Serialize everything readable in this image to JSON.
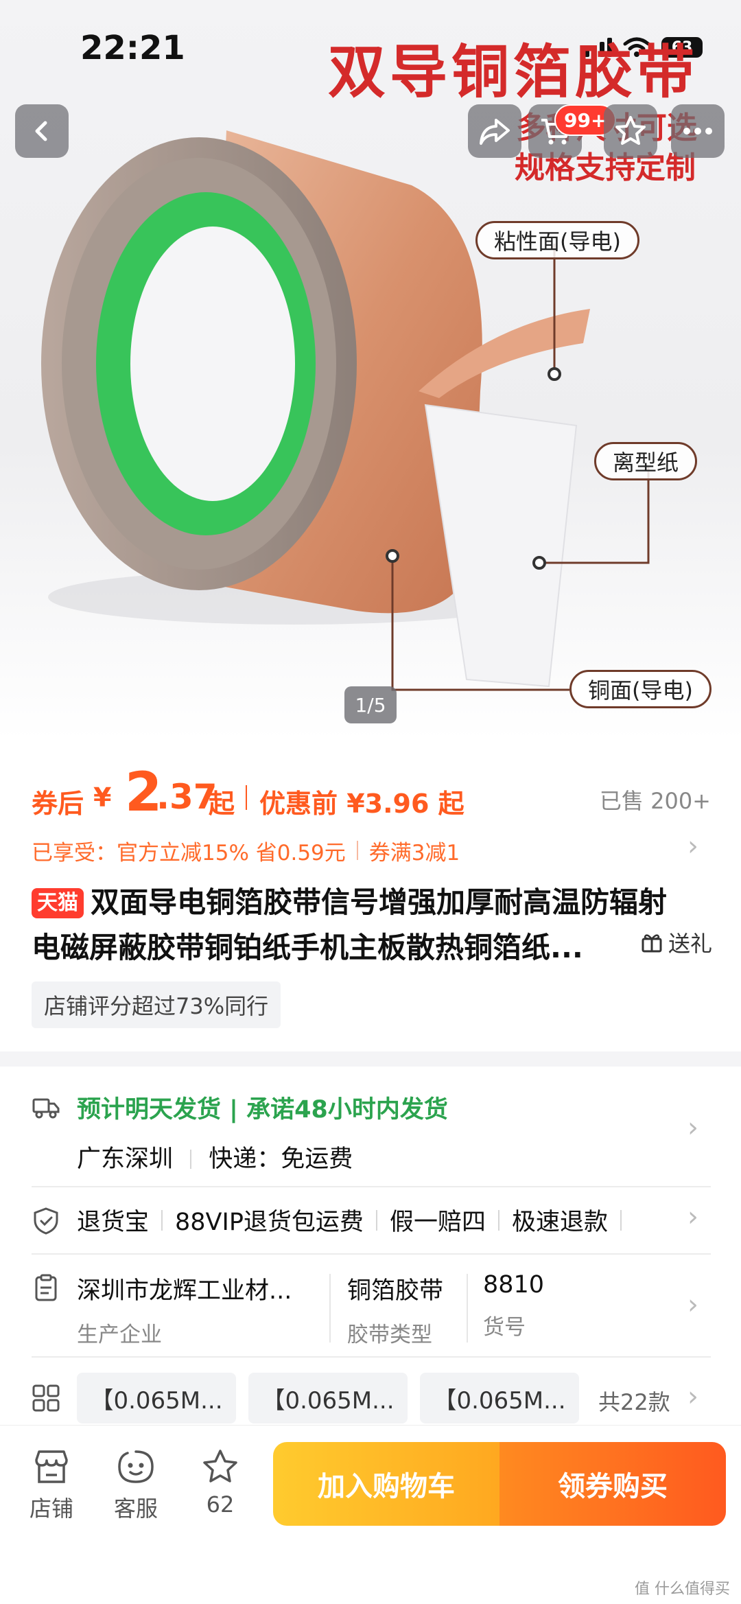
{
  "status_bar": {
    "time": "22:21",
    "battery": "63"
  },
  "hero": {
    "headline": "双导铜箔胶带",
    "sub_line1": "多种尺寸可选",
    "sub_line2": "规格支持定制",
    "callouts": {
      "adhesive": "粘性面(导电)",
      "release": "离型纸",
      "copper": "铜面(导电)"
    },
    "pager": "1/5",
    "cart_badge": "99+"
  },
  "price": {
    "label": "券后",
    "currency": "¥",
    "integer": "2",
    "decimal": ".37",
    "suffix": "起",
    "before_price": "优惠前 ¥3.96 起",
    "sold": "已售 200+"
  },
  "benefit": {
    "text1": "已享受：官方立减15% 省0.59元",
    "text2": "券满3减1"
  },
  "product": {
    "store_badge": "天猫",
    "title_line1": "双面导电铜箔胶带信号增强加厚耐高温防辐射",
    "title_line2": "电磁屏蔽胶带铜铂纸手机主板散热铜箔纸...",
    "gift": "送礼",
    "rating_tag": "店铺评分超过73%同行"
  },
  "shipping": {
    "estimate": "预计明天发货 | 承诺48小时内发货",
    "origin": "广东深圳",
    "express": "快递：免运费"
  },
  "guarantees": [
    "退货宝",
    "88VIP退货包运费",
    "假一赔四",
    "极速退款"
  ],
  "attributes": [
    {
      "value": "深圳市龙辉工业材...",
      "key": "生产企业"
    },
    {
      "value": "铜箔胶带",
      "key": "胶带类型"
    },
    {
      "value": "8810",
      "key": "货号"
    }
  ],
  "skus": [
    "【0.065M...",
    "【0.065M...",
    "【0.065M..."
  ],
  "sku_count": "共22款",
  "bottom_bar": {
    "store": "店铺",
    "service": "客服",
    "fav_count": "62",
    "add_cart": "加入购物车",
    "buy": "领券购买"
  },
  "watermark": "值 什么值得买",
  "colors": {
    "accent": "#ff5a1f",
    "green": "#2ba34e",
    "red": "#d42a2a",
    "tmall": "#ff3c2e"
  }
}
